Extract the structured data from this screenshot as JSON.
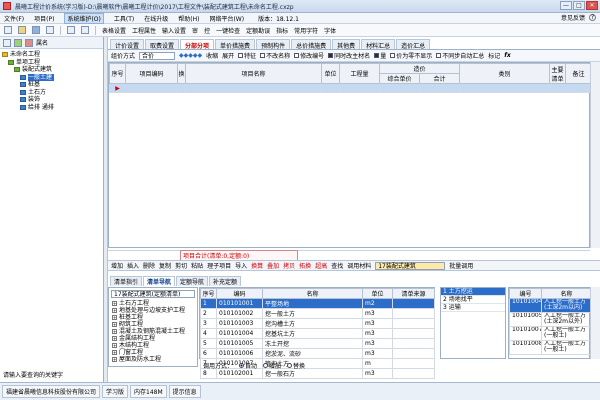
{
  "titlebar": {
    "title": "晨曦工程计价系统(学习版)-D:\\晨曦软件\\晨曦工程计价\\2017\\工程文件\\装配式建筑工程\\未命名工程.cxzp",
    "controls": [
      "—",
      "□",
      "✕"
    ]
  },
  "menubar": {
    "items": [
      "文件(F)",
      "项目(P)",
      "系统维护(O)",
      "工具(T)",
      "在线升级",
      "帮助(H)",
      "网络平台(W)"
    ],
    "active_index": 2,
    "version": "版本：18.12.1",
    "help_items": [
      "意见反馈"
    ]
  },
  "toolbar": {
    "labels": [
      "表格设置",
      "工程属性",
      "输入设置",
      "审",
      "控",
      "一键检查",
      "定额勘误",
      "指标",
      "常用字符",
      "字体"
    ]
  },
  "tree": {
    "header": "属名",
    "items": [
      {
        "label": "未命名工程",
        "level": 0,
        "icon": "y"
      },
      {
        "label": "单项工程",
        "level": 1,
        "icon": "g"
      },
      {
        "label": "装配式建筑",
        "level": 2,
        "icon": "g"
      },
      {
        "label": "一般土建",
        "level": 3,
        "icon": "b",
        "selected": true
      },
      {
        "label": "桩基",
        "level": 3,
        "icon": "b"
      },
      {
        "label": "土石方",
        "level": 3,
        "icon": "b"
      },
      {
        "label": "装饰",
        "level": 3,
        "icon": "b"
      },
      {
        "label": "给排 通排",
        "level": 3,
        "icon": "b"
      }
    ],
    "search_hint": "请输入要查询的关键字"
  },
  "tabs": {
    "items": [
      "计价设置",
      "取费设置",
      "分部分项",
      "单价措施费",
      "预制构件",
      "总价措施费",
      "其他费",
      "材料汇总",
      "造价汇总"
    ],
    "active_index": 2
  },
  "subbar": {
    "combo_label": "组价方式",
    "combo_value": "合价",
    "items": [
      "收缩",
      "展开",
      "特征",
      "不改名称",
      "修改编号",
      "同时改主材名",
      "量",
      "价为零不显示",
      "不同步自动汇总",
      "标记",
      "fx"
    ]
  },
  "grid": {
    "headers": [
      "序号",
      "项目编码",
      "换",
      "项目名称",
      "单位",
      "工程量",
      "综合单价",
      "合计",
      "类别",
      "主要清单",
      "备注"
    ],
    "group_header": "造价"
  },
  "calcrow": {
    "label": "项目合计(清单:0,定额:0)"
  },
  "midtool": {
    "items": [
      "增加",
      "插入",
      "删除",
      "复制",
      "剪切",
      "粘贴",
      "理子项目",
      "导入",
      "换算",
      "叠加",
      "拷贝",
      "拓换",
      "超高",
      "查找",
      "调用材料"
    ],
    "red_items": [
      "换算",
      "叠加",
      "拷贝",
      "拓换",
      "超高"
    ],
    "combo_value": "17装配式建筑",
    "batch": "批量调用"
  },
  "btabs": {
    "items": [
      "清单指引",
      "清单导航",
      "定额导航",
      "补充定额"
    ],
    "active_index": 1
  },
  "bleft": {
    "combo": "17装配式建筑(定额清单)",
    "tree": [
      "土石方工程",
      "地基处理与边坡支护工程",
      "桩基工程",
      "砌筑工程",
      "混凝土及钢筋混凝土工程",
      "金属结构工程",
      "木结构工程",
      "门窗工程",
      "屋面及防水工程",
      "保温、隔热、防腐工程"
    ]
  },
  "bmid": {
    "headers": [
      "序号",
      "编码",
      "名称",
      "单位",
      "清单来源"
    ],
    "rows": [
      [
        "1",
        "010101001",
        "平整场地",
        "m2",
        ""
      ],
      [
        "2",
        "010101002",
        "挖一般土方",
        "m3",
        ""
      ],
      [
        "3",
        "010101003",
        "挖沟槽土方",
        "m3",
        ""
      ],
      [
        "4",
        "010101004",
        "挖基坑土方",
        "m3",
        ""
      ],
      [
        "5",
        "010101005",
        "冻土开挖",
        "m3",
        ""
      ],
      [
        "6",
        "010101006",
        "挖淤泥、流砂",
        "m3",
        ""
      ],
      [
        "7",
        "010101007",
        "管沟土方",
        "m",
        ""
      ],
      [
        "8",
        "010102001",
        "挖一般石方",
        "m3",
        ""
      ]
    ],
    "selected_index": 0
  },
  "bright1": {
    "items": [
      "1 土方挖运",
      "2 场地找平",
      "3 运输"
    ],
    "selected_index": 0
  },
  "bright2": {
    "headers": [
      "编号",
      "名称"
    ],
    "rows": [
      [
        "10101004",
        "人工挖一般土方(土深2m以内)"
      ],
      [
        "10101005",
        "人工挖一般土方(土深2m以外)"
      ],
      [
        "10101007",
        "人工挖一般土方(一般土)"
      ],
      [
        "10101008",
        "人工挖一般土方(一般土)"
      ]
    ],
    "selected_index": 0
  },
  "useway": {
    "label": "调用方式：",
    "options": [
      "自动",
      "增加",
      "替换"
    ],
    "selected_index": 0
  },
  "status": {
    "items": [
      "福建省晨曦信息科技股份有限公司",
      "学习版",
      "内存148M",
      "提示信息"
    ]
  }
}
